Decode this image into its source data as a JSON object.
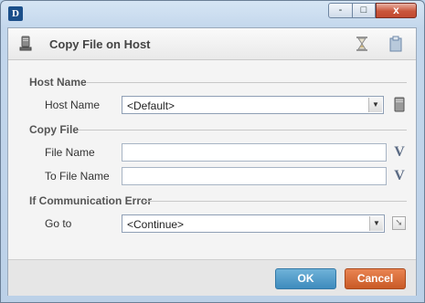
{
  "window": {
    "logo_text": "D",
    "controls": {
      "minimize": "-",
      "maximize": "□",
      "close": "x"
    }
  },
  "header": {
    "title": "Copy File on Host",
    "icons": [
      "server-icon",
      "hourglass-icon",
      "clipboard-icon"
    ]
  },
  "sections": {
    "host_name": {
      "heading": "Host Name",
      "host_label": "Host Name",
      "host_value": "<Default>"
    },
    "copy_file": {
      "heading": "Copy File",
      "file_label": "File Name",
      "file_value": "",
      "to_file_label": "To File Name",
      "to_file_value": "",
      "variable_button": "V"
    },
    "comm_error": {
      "heading": "If Communication Error",
      "goto_label": "Go to",
      "goto_value": "<Continue>"
    }
  },
  "footer": {
    "ok_label": "OK",
    "cancel_label": "Cancel"
  },
  "colors": {
    "ok": "#4a96c6",
    "cancel": "#d8683a",
    "window_frame": "#c3d7ec"
  }
}
